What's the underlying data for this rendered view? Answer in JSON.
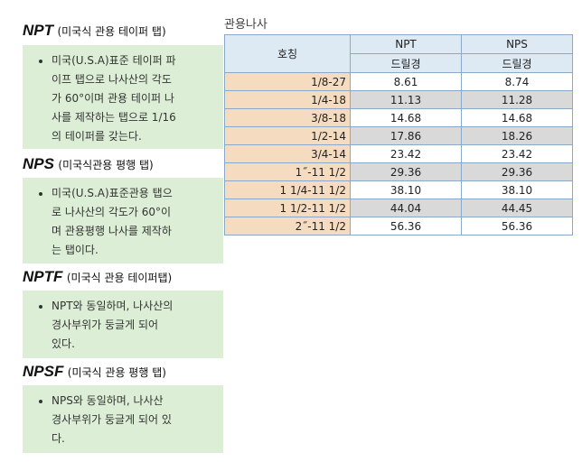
{
  "sections": [
    {
      "abbr": "NPT",
      "sub": "(미국식 관용 테이퍼 탭)",
      "lines": [
        "미국(U.S.A)표준 테이퍼 파",
        "이프 탭으로 나사산의 각도",
        "가 60°이며 관용 테이퍼 나",
        "사를 제작하는 탭으로 1/16",
        "의 테이퍼를 갖는다."
      ]
    },
    {
      "abbr": "NPS",
      "sub": "(미국식관용 평행 탭)",
      "lines": [
        "미국(U.S.A)표준관용 탭으",
        "로 나사산의 각도가 60°이",
        "며 관용평행 나사를 제작하",
        "는 탭이다."
      ]
    },
    {
      "abbr": "NPTF",
      "sub": "(미국식 관용 테이퍼탭)",
      "lines": [
        "NPT와 동일하며, 나사산의",
        "경사부위가 둥글게 되어",
        "있다."
      ]
    },
    {
      "abbr": "NPSF",
      "sub": "(미국식 관용 평행 탭)",
      "lines": [
        "NPS와 동일하며, 나사산",
        "경사부위가 둥글게 되어 있",
        "다."
      ]
    }
  ],
  "table": {
    "caption": "관용나사",
    "head": {
      "col1": "호칭",
      "col2": "NPT",
      "col3": "NPS",
      "sub2": "드릴경",
      "sub3": "드릴경"
    },
    "rows": [
      {
        "size": "1/8-27",
        "npt": "8.61",
        "nps": "8.74"
      },
      {
        "size": "1/4-18",
        "npt": "11.13",
        "nps": "11.28"
      },
      {
        "size": "3/8-18",
        "npt": "14.68",
        "nps": "14.68"
      },
      {
        "size": "1/2-14",
        "npt": "17.86",
        "nps": "18.26"
      },
      {
        "size": "3/4-14",
        "npt": "23.42",
        "nps": "23.42"
      },
      {
        "size": "1˝-11 1/2",
        "npt": "29.36",
        "nps": "29.36"
      },
      {
        "size": "1 1/4-11 1/2",
        "npt": "38.10",
        "nps": "38.10"
      },
      {
        "size": "1 1/2-11 1/2",
        "npt": "44.04",
        "nps": "44.45"
      },
      {
        "size": "2˝-11 1/2",
        "npt": "56.36",
        "nps": "56.36"
      }
    ]
  }
}
